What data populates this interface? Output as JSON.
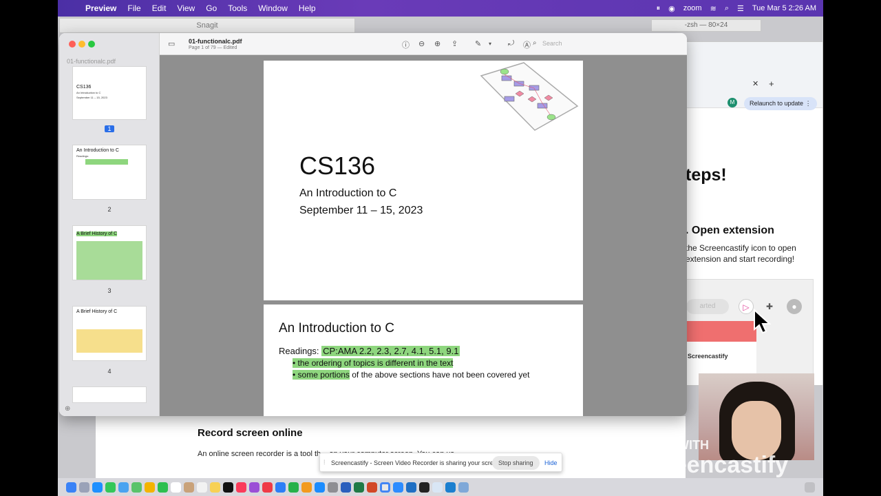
{
  "menubar": {
    "app": "Preview",
    "items": [
      "File",
      "Edit",
      "View",
      "Go",
      "Tools",
      "Window",
      "Help"
    ],
    "zoom": "zoom",
    "clock": "Tue Mar 5  2:26 AM"
  },
  "snagit_title": "Snagit",
  "terminal_title": "-zsh — 80×24",
  "preview": {
    "sidebar_title": "01-functionalc.pdf",
    "doc_title": "01-functionalc.pdf",
    "doc_subtitle": "Page 1 of 79 — Edited",
    "search_placeholder": "Search",
    "thumbnails": [
      {
        "page": "1",
        "line1": "CS136",
        "line2": "An Introduction to C",
        "line3": "September 11 – 15, 2023"
      },
      {
        "page": "2",
        "line1": "An Introduction to C",
        "line2": "Readings:",
        "line3": ""
      },
      {
        "page": "3",
        "line1": "A Brief History of C",
        "line2": "",
        "line3": ""
      },
      {
        "page": "4",
        "line1": "A Brief History of C",
        "line2": "",
        "line3": ""
      }
    ],
    "page1": {
      "title": "CS136",
      "subtitle": "An Introduction to C",
      "dates": "September 11 – 15, 2023"
    },
    "page2": {
      "title": "An Introduction to C",
      "readings_label": "Readings:",
      "readings_value": "CP:AMA 2.2, 2.3, 2.7, 4.1, 5.1, 9.1",
      "bullet1": "the ordering of topics is different in the text",
      "bullet2_hl": "some portions",
      "bullet2_rest": " of the above sections have not been covered yet"
    }
  },
  "chrome": {
    "relaunch": "Relaunch to update",
    "avatar": "M",
    "steps_heading": "teps!",
    "open_ext": ". Open extension",
    "open_ext_desc": "the Screencastify icon to open extension and start recording!",
    "started_label": "arted",
    "tile_label": "Screencastify"
  },
  "webpage": {
    "heading": "Record screen online",
    "paragraph": "An online screen recorder is a tool th... on your computer screen. You can us..."
  },
  "sharebar": {
    "message": "Screencastify - Screen Video Recorder is sharing your screen.",
    "stop": "Stop sharing",
    "hide": "Hide"
  },
  "watermark": {
    "made_with": "MADE WITH",
    "brand": "Screencastify"
  },
  "colors": {
    "menubar": "#5a35b0",
    "highlight": "#8ed67e",
    "selection": "#2a6ee8"
  }
}
